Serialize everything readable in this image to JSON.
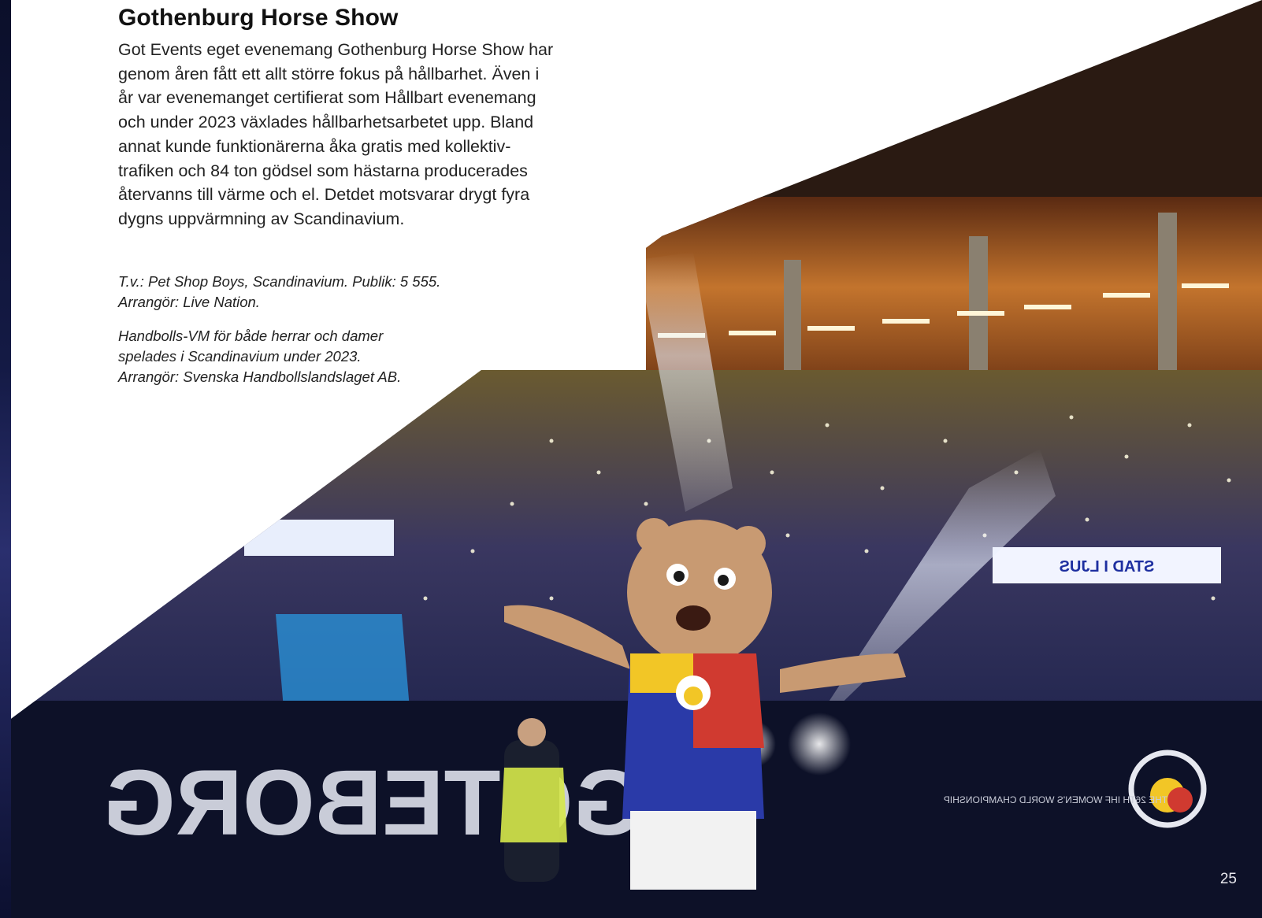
{
  "section": {
    "title": "Gothenburg Horse Show",
    "body": "Got Events eget evenemang Gothenburg Horse Show har\ngenom åren fått ett allt större fokus på hållbarhet. Även i\når var evenemanget certifierat som Hållbart evenemang\noch under 2023 växlades hållbarhetsarbetet upp. Bland\nannat kunde funktionärerna åka gratis med kollektiv-\ntrafiken och 84 ton gödsel som hästarna producerades\nåtervanns till värme och el. Detdet motsvarar drygt fyra\ndygns uppvärmning av Scandinavium."
  },
  "captions": {
    "caption1": "T.v.: Pet Shop Boys, Scandinavium. Publik: 5 555.\nArrangör: Live Nation.",
    "caption2": "Handbolls-VM för både herrar och damer\nspelades i Scandinavium under 2023.\nArrangör: Svenska Handbollslandslaget AB."
  },
  "photo": {
    "banner_left_text": "GÖTEBORG",
    "banner_stad": "STAD I LJUS",
    "banner_event_text": "THE 26TH IHF WOMEN'S WORLD CHAMPIONSHIP",
    "colors": {
      "arena_dark": "#0d1128",
      "seats_blue": "#3a3f8f",
      "wall_orange": "#b8682a",
      "mascot_fur": "#c89a72",
      "shirt_blue": "#2a3aa8",
      "shirt_red": "#d03a30",
      "shirt_yellow": "#f2c626"
    }
  },
  "page": {
    "number": "25"
  }
}
